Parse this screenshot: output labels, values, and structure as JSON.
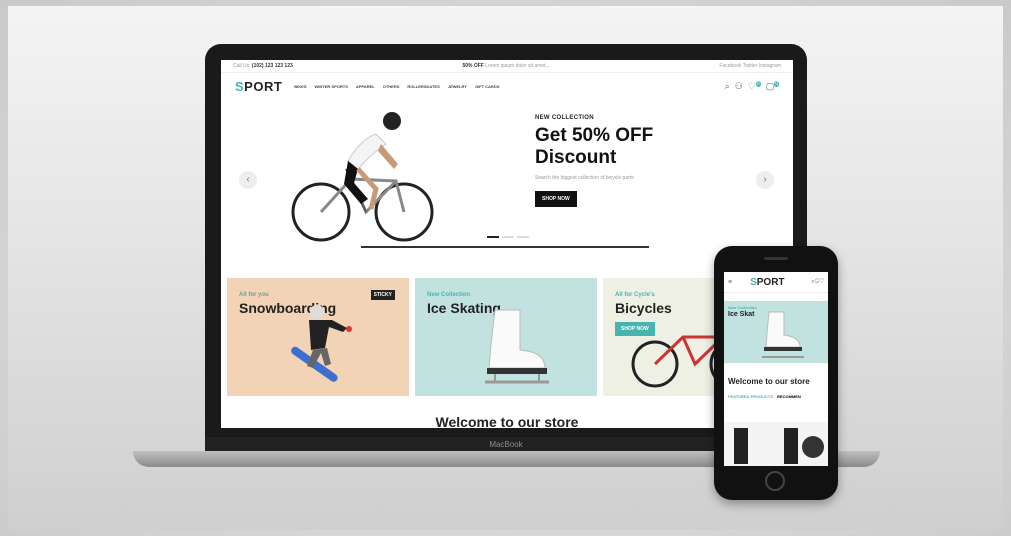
{
  "topbar": {
    "call_label": "Call Us:",
    "call_number": "(102) 123 123 123",
    "promo_bold": "50% OFF",
    "promo_text": "Lorem ipsum dolor sit amet...",
    "social": "Facebook  Twitter  Instagram"
  },
  "nav": {
    "logo_initial": "S",
    "logo_rest": "PORT",
    "menu": [
      "BIKES",
      "WINTER SPORTS",
      "APPAREL",
      "OTHERS",
      "ROLLERSKATES",
      "JEWELRY",
      "GIFT CARDS"
    ],
    "wishlist_count": "0",
    "cart_count": "0"
  },
  "hero": {
    "eyebrow": "NEW COLLECTION",
    "headline_line1": "Get 50% OFF",
    "headline_line2": "Discount",
    "subtext": "Search the biggest collection of bicycle parts",
    "button": "SHOP NOW",
    "prev_arrow": "‹",
    "next_arrow": "›"
  },
  "categories": [
    {
      "tag": "All for you",
      "title": "Snowboarding",
      "badge": "STICKY",
      "bg": "#f2d3b6",
      "tag_color": "#6aa48d"
    },
    {
      "tag": "New Collection",
      "title": "Ice Skating",
      "bg": "#c2e2e0",
      "tag_color": "#48b4b1"
    },
    {
      "tag": "All for Cycle's",
      "title": "Bicycles",
      "button": "SHOP NOW",
      "bg": "#eef0e4",
      "tag_color": "#48b4b1"
    }
  ],
  "welcome": "Welcome to our store",
  "laptop_brand": "MacBook",
  "phone": {
    "logo_initial": "S",
    "logo_rest": "PORT",
    "hero_tag": "New Collection",
    "hero_title": "Ice Skat",
    "welcome": "Welcome to our store",
    "tab_featured": "FEATURED PRODUCTS",
    "tab_recommended": "RECOMMEN"
  },
  "colors": {
    "accent": "#48b4b1",
    "dark": "#111111"
  }
}
